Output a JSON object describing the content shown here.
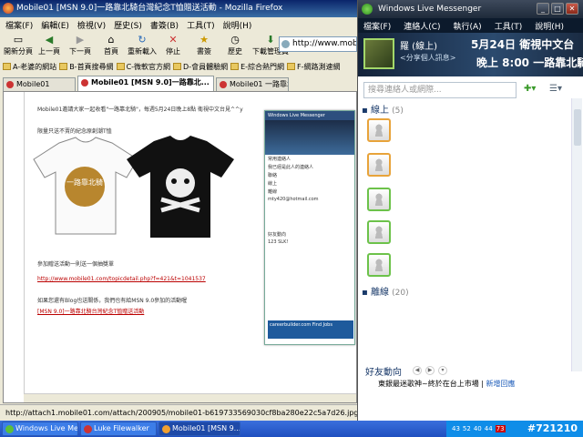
{
  "firefox": {
    "title": "Mobile01 [MSN 9.0]一路靠北騎台灣紀念T恤贈送活動 - Mozilla Firefox",
    "menu": [
      "檔案(F)",
      "編輯(E)",
      "檢視(V)",
      "歷史(S)",
      "書簽(B)",
      "工具(T)",
      "說明(H)"
    ],
    "toolbar": [
      {
        "label": "開新分頁",
        "icon": "new-tab-icon"
      },
      {
        "label": "上一頁",
        "icon": "back-icon"
      },
      {
        "label": "下一頁",
        "icon": "forward-icon"
      },
      {
        "label": "首頁",
        "icon": "home-icon"
      },
      {
        "label": "重新載入",
        "icon": "reload-icon"
      },
      {
        "label": "停止",
        "icon": "stop-icon"
      },
      {
        "label": "書簽",
        "icon": "bookmark-icon"
      },
      {
        "label": "歷史",
        "icon": "history-icon"
      },
      {
        "label": "下載管理員",
        "icon": "download-icon"
      }
    ],
    "url": "http://www.mobile01.com",
    "bookmarks": [
      "A-老婆的網站",
      "B-首頁搜尋網",
      "C-微軟官方網",
      "D-會員體驗網",
      "E-綜合熱門網",
      "F-網路測速網"
    ],
    "tabs": [
      "Mobile01",
      "Mobile01 [MSN 9.0]一路靠北...",
      "Mobile01 一路靠北..."
    ],
    "status": "http://attach1.mobile01.com/attach/200905/mobile01-b619733569030cf8ba280e22c5a7d26.jpg",
    "page": {
      "line1": "Mobile01邀請大家一起收看\"一路靠北騎\"，每週5月24日晚上8點 衛視中文台見^^y",
      "line2": "限量只送不賣的紀念原創潮T恤",
      "shirt_text": "一路靠北騎",
      "line3": "參加贈送活動一則送一個抽獎單",
      "link1": "http://www.mobile01.com/topicdetail.php?f=421&t=1041537",
      "line4": "如果您還有Blog也送關係，我們也有給MSN 9.0參加的活動喔",
      "link2": "[MSN 9.0]一路靠北騎台灣紀念T恤贈送活動",
      "mini_title": "Windows Live Messenger",
      "mini_items": [
        "常用連絡人",
        "我已經是此人的連絡人",
        "聯絡",
        "線上",
        "離線",
        "mty420@hotmail.com",
        "好友動向",
        "123 SLK!"
      ],
      "mini_ad": "careerbuilder.com  Find Jobs"
    }
  },
  "messenger": {
    "title": "Windows Live Messenger",
    "menu": [
      "檔案(F)",
      "連絡人(C)",
      "執行(A)",
      "工具(T)",
      "說明(H)"
    ],
    "user_name": "羅 (線上)",
    "personal_message": "<分享個人訊息>",
    "ad_line1": "5月24日 衛視中文台",
    "ad_line2": "晚上 8:00 一路靠北騎",
    "search_placeholder": "搜尋連絡人或網際...",
    "groups": [
      {
        "name": "線上",
        "count": "(5)"
      },
      {
        "name": "離線",
        "count": "(20)"
      }
    ],
    "feed_title": "好友動向",
    "feed_item": "東銀最迷歌神~終於在台上市場",
    "feed_link": "新增回應"
  },
  "taskbar": {
    "tasks": [
      "Windows Live Me...",
      "Luke Filewalker",
      "Mobile01 [MSN 9...."
    ],
    "clock": "#721210",
    "tray": [
      "43",
      "52",
      "40",
      "44",
      "73"
    ]
  },
  "colors": {
    "title_bar": "#0a246a",
    "messenger_bg": "#14233a",
    "taskbar": "#1f4fc0",
    "online": "#6cc24a",
    "busy": "#e8a33a"
  }
}
